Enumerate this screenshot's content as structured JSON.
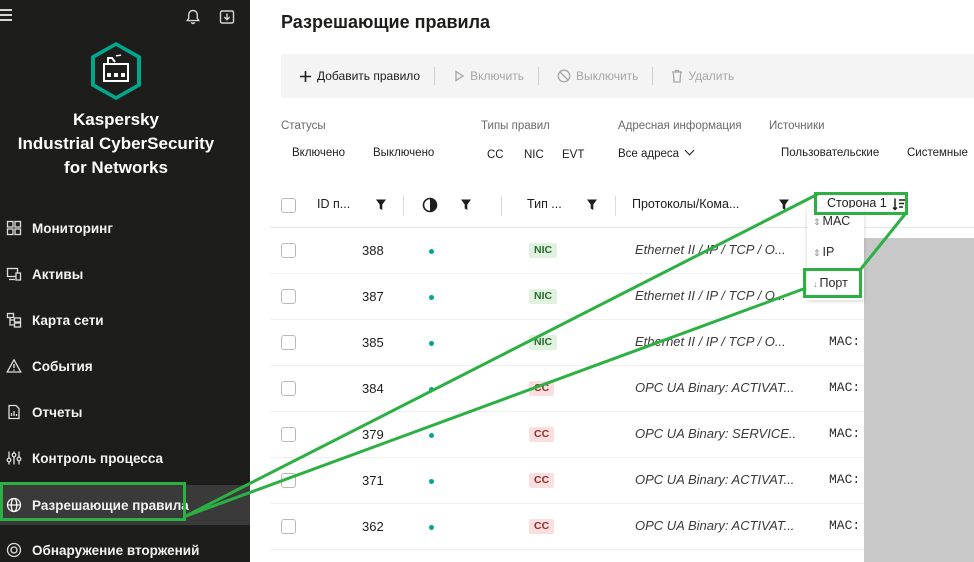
{
  "sidebar": {
    "brand_line1": "Kaspersky",
    "brand_line2": "Industrial CyberSecurity",
    "brand_line3": "for Networks",
    "items": [
      {
        "label": "Мониторинг",
        "icon": "dashboard-icon"
      },
      {
        "label": "Активы",
        "icon": "devices-icon"
      },
      {
        "label": "Карта сети",
        "icon": "network-map-icon"
      },
      {
        "label": "События",
        "icon": "warning-icon"
      },
      {
        "label": "Отчеты",
        "icon": "report-icon"
      },
      {
        "label": "Контроль процесса",
        "icon": "process-control-icon"
      },
      {
        "label": "Разрешающие правила",
        "icon": "globe-icon",
        "active": true
      },
      {
        "label": "Обнаружение вторжений",
        "icon": "intrusion-icon"
      }
    ]
  },
  "page": {
    "title": "Разрешающие правила"
  },
  "toolbar": {
    "add": "Добавить правило",
    "enable": "Включить",
    "disable": "Выключить",
    "delete": "Удалить"
  },
  "filters": {
    "statuses_label": "Статусы",
    "status_on": "Включено",
    "status_off": "Выключено",
    "types_label": "Типы правил",
    "type_cc": "CC",
    "type_nic": "NIC",
    "type_evt": "EVT",
    "address_label": "Адресная информация",
    "address_value": "Все адреса",
    "sources_label": "Источники",
    "source_user": "Пользовательские",
    "source_system": "Системные"
  },
  "table": {
    "headers": {
      "id": "ID п...",
      "type": "Тип ...",
      "protocols": "Протоколы/Кома...",
      "side1": "Сторона 1"
    },
    "rows": [
      {
        "id": "388",
        "type": "NIC",
        "kind": "nic",
        "protocol": "Ethernet II / IP / TCP / O...",
        "side": ""
      },
      {
        "id": "387",
        "type": "NIC",
        "kind": "nic",
        "protocol": "Ethernet II / IP / TCP / O...",
        "side": ""
      },
      {
        "id": "385",
        "type": "NIC",
        "kind": "nic",
        "protocol": "Ethernet II / IP / TCP / O...",
        "side": "MAC:"
      },
      {
        "id": "384",
        "type": "CC",
        "kind": "cc",
        "protocol": "OPC UA Binary: ACTIVAT...",
        "side": "MAC:"
      },
      {
        "id": "379",
        "type": "CC",
        "kind": "cc",
        "protocol": "OPC UA Binary: SERVICE...",
        "side": "MAC:"
      },
      {
        "id": "371",
        "type": "CC",
        "kind": "cc",
        "protocol": "OPC UA Binary: ACTIVAT...",
        "side": "MAC:"
      },
      {
        "id": "362",
        "type": "CC",
        "kind": "cc",
        "protocol": "OPC UA Binary: ACTIVAT...",
        "side": "MAC:"
      }
    ]
  },
  "sort_menu": {
    "items": [
      "MAC",
      "IP",
      "Порт"
    ],
    "selected": "Порт"
  },
  "colors": {
    "sidebar_bg": "#1d1d1b",
    "accent": "#00a88e",
    "highlight": "#2db043"
  }
}
